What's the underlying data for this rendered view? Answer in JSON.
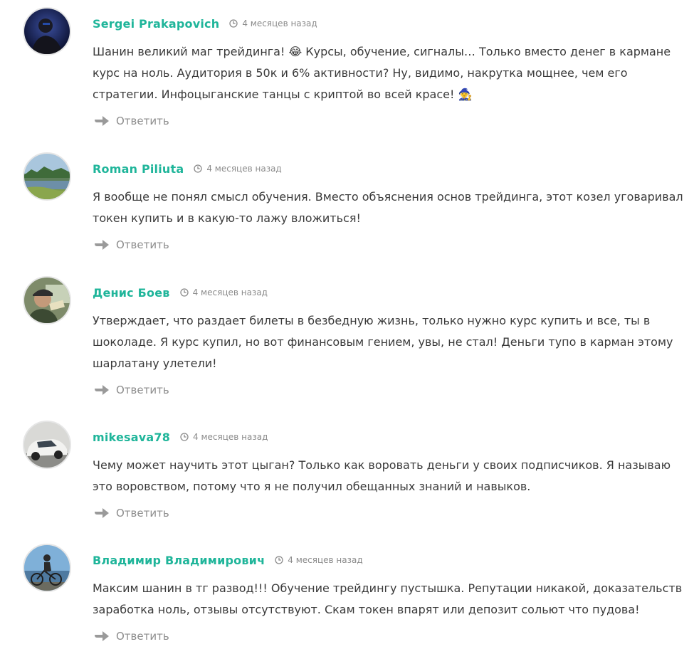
{
  "comments": [
    {
      "author": "Sergei Prakapovich",
      "time": "4 месяцев назад",
      "text": "Шанин великий маг трейдинга! 😂 Курсы, обучение, сигналы… Только вместо денег в кармане курс на ноль. Аудитория в 50к и 6% активности? Ну, видимо, накрутка мощнее, чем его стратегии. Инфоцыганские танцы с криптой во всей красе! 🧙",
      "reply_label": "Ответить",
      "avatar_icon": "user-avatar-dark-portrait"
    },
    {
      "author": "Roman Piliuta",
      "time": "4 месяцев назад",
      "text": "Я вообще не понял смысл обучения. Вместо объяснения основ трейдинга, этот козел уговаривал токен купить и в какую-то лажу вложиться!",
      "reply_label": "Ответить",
      "avatar_icon": "user-avatar-lake-landscape"
    },
    {
      "author": "Денис Боев",
      "time": "4 месяцев назад",
      "text": "Утверждает, что раздает билеты в безбедную жизнь, только нужно курс купить и все, ты в шоколаде. Я курс купил, но вот финансовым гением, увы, не стал! Деньги тупо в карман этому шарлатану улетели!",
      "reply_label": "Ответить",
      "avatar_icon": "user-avatar-man-with-cap"
    },
    {
      "author": "mikesava78",
      "time": "4 месяцев назад",
      "text": "Чему может научить этот цыган? Только как воровать деньги у своих подписчиков. Я называю это воровством, потому что я не получил обещанных знаний и навыков.",
      "reply_label": "Ответить",
      "avatar_icon": "user-avatar-white-car"
    },
    {
      "author": "Владимир Владимирович",
      "time": "4 месяцев назад",
      "text": "Максим шанин в тг развод!!! Обучение трейдингу пустышка. Репутации никакой, доказательств заработка ноль, отзывы отсутствуют. Скам токен впарят или депозит сольют что пудова!",
      "reply_label": "Ответить",
      "avatar_icon": "user-avatar-cyclist"
    }
  ],
  "colors": {
    "author": "#1fb59a",
    "text": "#3a3a3a",
    "meta": "#8a8a8a",
    "reply": "#8d8d8d"
  }
}
